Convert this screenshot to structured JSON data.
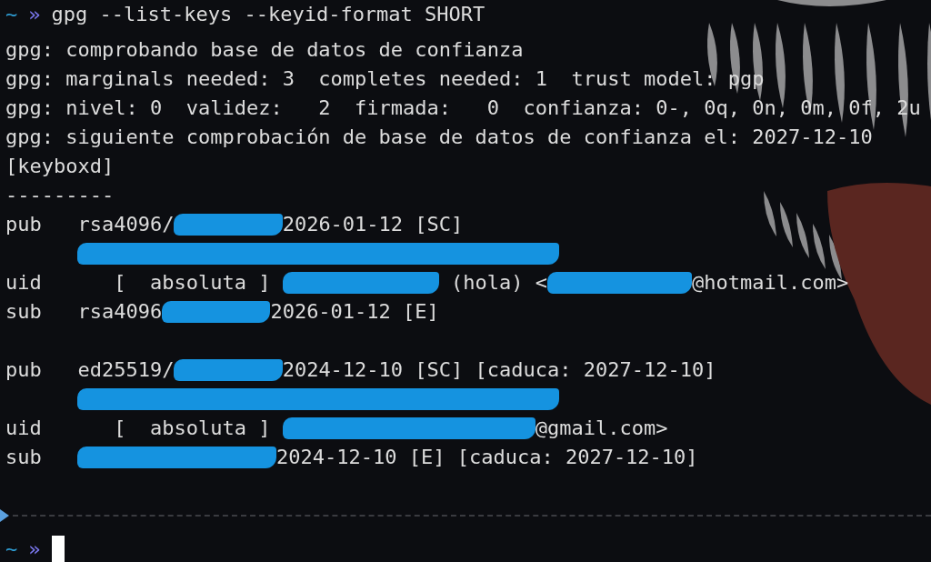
{
  "lines": [
    {
      "kind": "prompt",
      "cwd": "~",
      "symbol": "»",
      "command": "gpg --list-keys --keyid-format SHORT"
    },
    {
      "kind": "output",
      "segments": [
        {
          "kind": "text",
          "text": "gpg: comprobando base de datos de confianza"
        }
      ]
    },
    {
      "kind": "output",
      "segments": [
        {
          "kind": "text",
          "text": "gpg: marginals needed: 3  completes needed: 1  trust model: pgp"
        }
      ]
    },
    {
      "kind": "output",
      "segments": [
        {
          "kind": "text",
          "text": "gpg: nivel: 0  validez:   2  firmada:   0  confianza: 0-, 0q, 0n, 0m, 0f, 2u"
        }
      ]
    },
    {
      "kind": "output",
      "segments": [
        {
          "kind": "text",
          "text": "gpg: siguiente comprobación de base de datos de confianza el: 2027-12-10"
        }
      ]
    },
    {
      "kind": "output",
      "segments": [
        {
          "kind": "text",
          "text": "[keyboxd]"
        }
      ]
    },
    {
      "kind": "output",
      "segments": [
        {
          "kind": "text",
          "text": "---------"
        }
      ]
    },
    {
      "kind": "output",
      "segments": [
        {
          "kind": "text",
          "text": "pub   rsa4096/"
        },
        {
          "kind": "redact-key"
        },
        {
          "kind": "text",
          "text": "2026-01-12 [SC]"
        }
      ]
    },
    {
      "kind": "output",
      "segments": [
        {
          "kind": "indent"
        },
        {
          "kind": "redact-fingerprint"
        }
      ]
    },
    {
      "kind": "output",
      "segments": [
        {
          "kind": "text",
          "text": "uid      [  absoluta ] "
        },
        {
          "kind": "redact-name"
        },
        {
          "kind": "text",
          "text": " (hola) <"
        },
        {
          "kind": "redact-email"
        },
        {
          "kind": "text",
          "text": "@hotmail.com>"
        }
      ]
    },
    {
      "kind": "output",
      "segments": [
        {
          "kind": "text",
          "text": "sub   rsa4096"
        },
        {
          "kind": "redact-key"
        },
        {
          "kind": "text",
          "text": "2026-01-12 [E]"
        }
      ]
    },
    {
      "kind": "blank"
    },
    {
      "kind": "output",
      "segments": [
        {
          "kind": "text",
          "text": "pub   ed25519/"
        },
        {
          "kind": "redact-key"
        },
        {
          "kind": "text",
          "text": "2024-12-10 [SC] [caduca: 2027-12-10]"
        }
      ]
    },
    {
      "kind": "output",
      "segments": [
        {
          "kind": "indent"
        },
        {
          "kind": "redact-fingerprint"
        }
      ]
    },
    {
      "kind": "output",
      "segments": [
        {
          "kind": "text",
          "text": "uid      [  absoluta ] "
        },
        {
          "kind": "redact-name-email"
        },
        {
          "kind": "text",
          "text": "@gmail.com>"
        }
      ]
    },
    {
      "kind": "output",
      "segments": [
        {
          "kind": "text",
          "text": "sub   "
        },
        {
          "kind": "redact-algo-key"
        },
        {
          "kind": "text",
          "text": "2024-12-10 [E] [caduca: 2027-12-10]"
        }
      ]
    },
    {
      "kind": "blank"
    },
    {
      "kind": "separator"
    },
    {
      "kind": "prompt",
      "cwd": "~",
      "symbol": "»",
      "cursor": true
    }
  ]
}
